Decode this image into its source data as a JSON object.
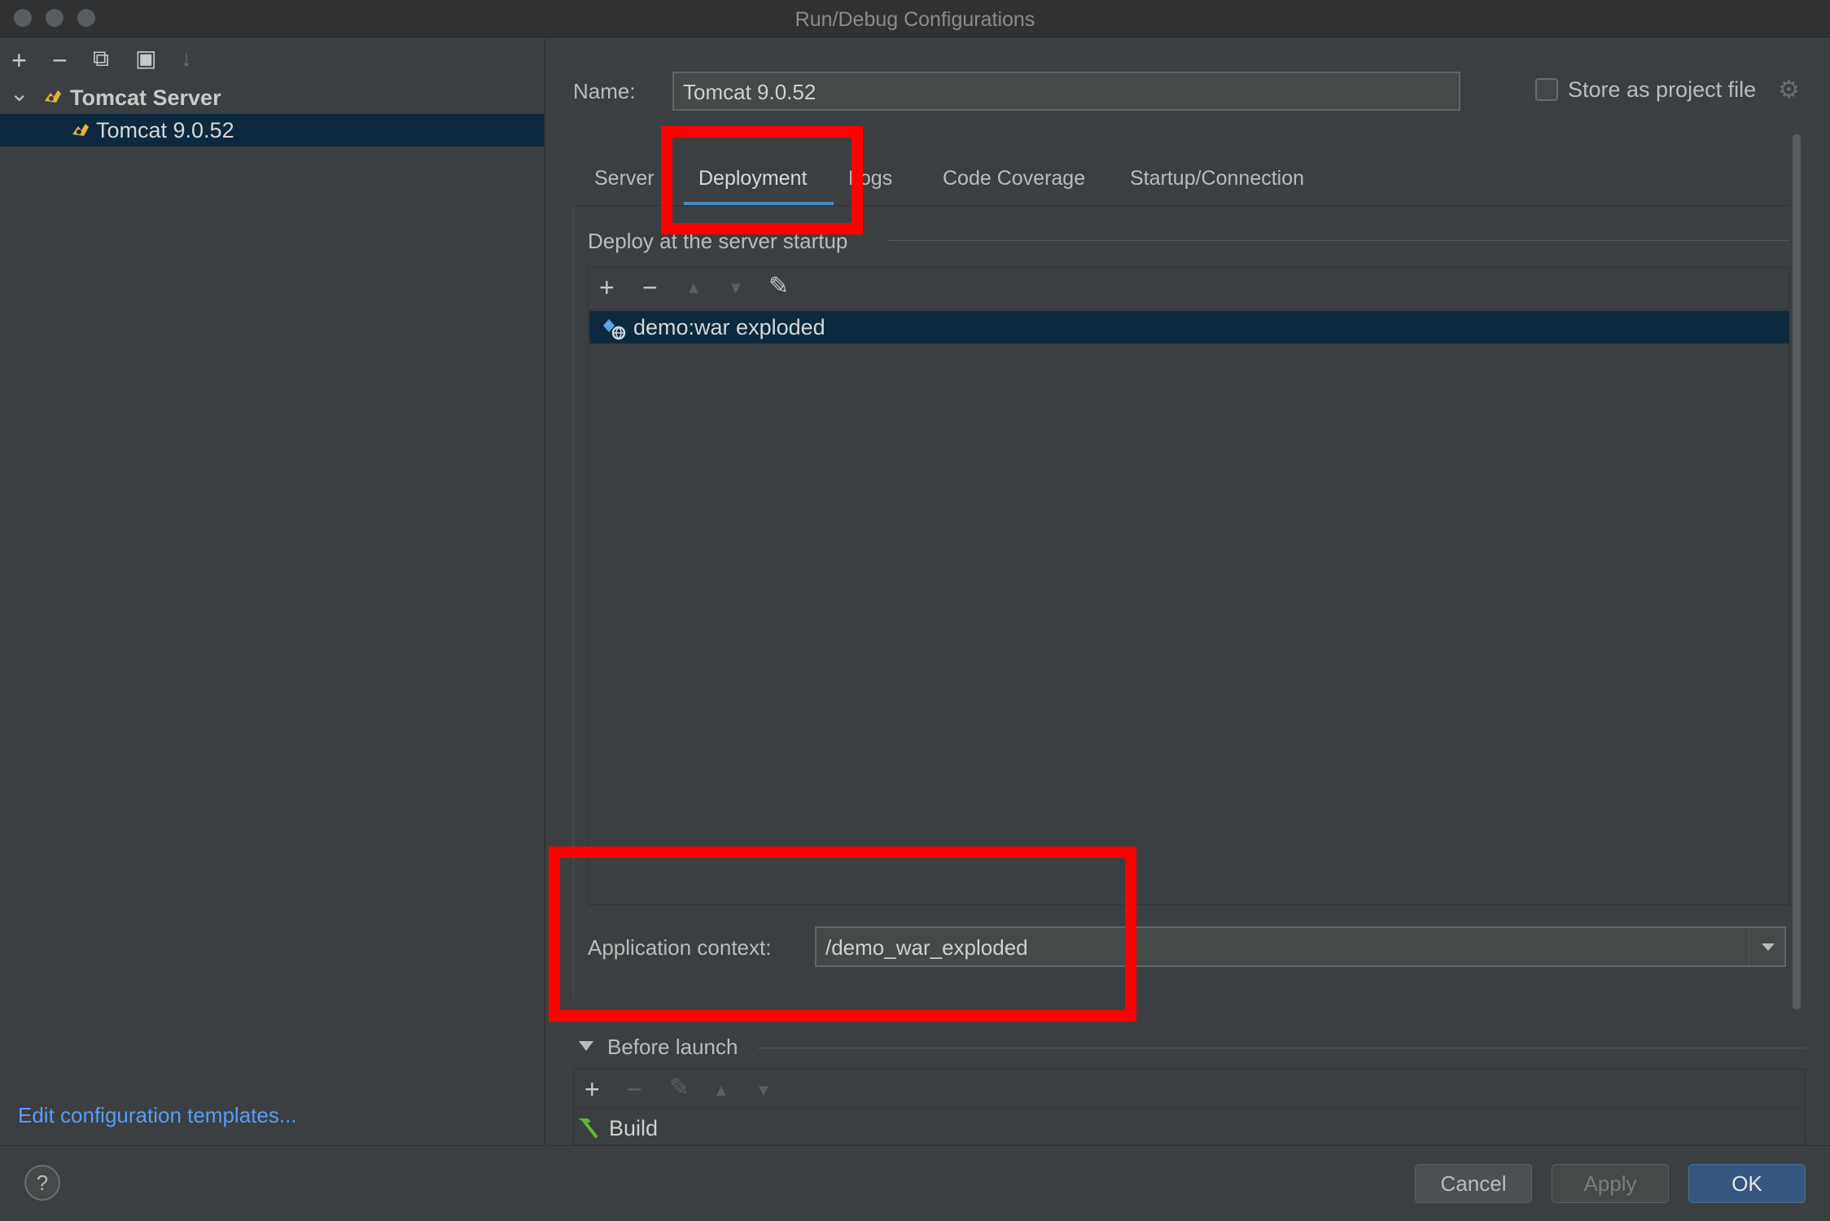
{
  "window": {
    "title": "Run/Debug Configurations"
  },
  "left_toolbar": {
    "add": "+",
    "remove": "−",
    "copy": "⧉",
    "folder": "▣",
    "sort": "↓"
  },
  "tree": {
    "group_label": "Tomcat Server",
    "child_label": "Tomcat 9.0.52",
    "chevron": "⌄"
  },
  "name_field": {
    "label": "Name:",
    "value": "Tomcat 9.0.52"
  },
  "store_project": {
    "label": "Store as project file",
    "gear": "⚙"
  },
  "tabs": [
    {
      "label": "Server"
    },
    {
      "label": "Deployment"
    },
    {
      "label": "Logs"
    },
    {
      "label": "Code Coverage"
    },
    {
      "label": "Startup/Connection"
    }
  ],
  "deploy": {
    "section_title": "Deploy at the server startup",
    "toolbar": {
      "add": "+",
      "remove": "−",
      "up": "▲",
      "down": "▼",
      "edit": "✎"
    },
    "items": [
      {
        "label": "demo:war exploded"
      }
    ]
  },
  "app_context": {
    "label": "Application context:",
    "value": "/demo_war_exploded"
  },
  "before_launch": {
    "title": "Before launch",
    "toolbar": {
      "add": "+",
      "remove": "−",
      "edit": "✎",
      "up": "▲",
      "down": "▼"
    },
    "items": [
      {
        "label": "Build"
      }
    ]
  },
  "footer": {
    "edit_templates": "Edit configuration templates...",
    "help": "?",
    "cancel": "Cancel",
    "apply": "Apply",
    "ok": "OK"
  },
  "colors": {
    "accent": "#4a88c7",
    "selection": "#0d293e",
    "highlight": "#ff0000",
    "link": "#589df6"
  }
}
